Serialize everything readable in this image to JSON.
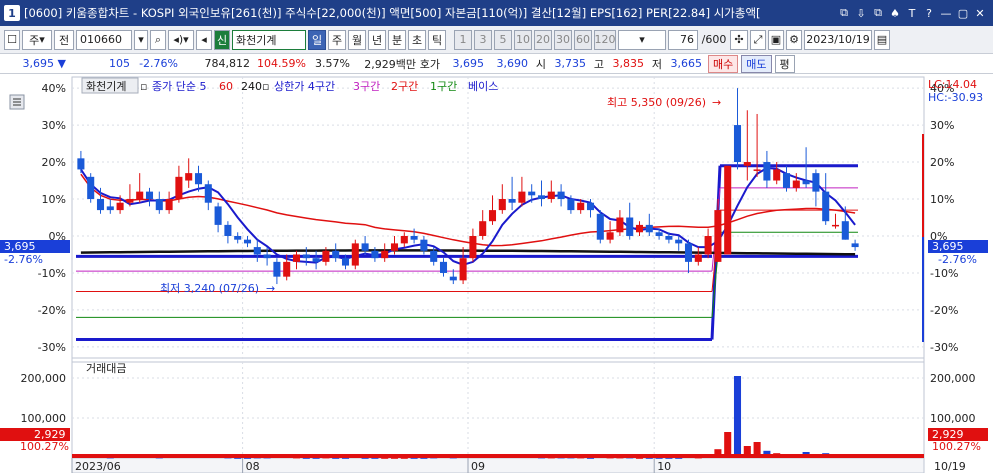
{
  "window": {
    "number": "1",
    "title": "[0600] 키움종합차트 - KOSPI 외국인보유[261(천)] 주식수[22,000(천)] 액면[500] 자본금[110(억)] 결산[12월] EPS[162] PER[22.84] 시가총액[",
    "buttons": [
      "⧉",
      "⇩",
      "⧉",
      "♠",
      "T",
      "?",
      "—",
      "▢",
      "✕"
    ]
  },
  "toolbar": {
    "mode1": "주",
    "mode2": "전",
    "code": "010660",
    "signal_label": "신",
    "stock_name": "화천기계",
    "periods": [
      "일",
      "주",
      "월",
      "년",
      "분",
      "초",
      "틱"
    ],
    "selected_period": "일",
    "intervals": [
      "1",
      "3",
      "5",
      "10",
      "20",
      "30",
      "60",
      "120"
    ],
    "count_value": "76",
    "count_total": "/600",
    "date": "2023/10/19"
  },
  "pricebar": {
    "price": "3,695",
    "change": "105",
    "change_pct": "-2.76%",
    "volume": "784,812",
    "volume_ratio": "104.59%",
    "turnover": "3.57%",
    "amount": "2,929백만",
    "quote_label": "호가",
    "ask": "3,695",
    "bid": "3,690",
    "open_label": "시",
    "open": "3,735",
    "high_label": "고",
    "high": "3,835",
    "low_label": "저",
    "low": "3,665",
    "buy_label": "매수",
    "sell_label": "매도",
    "eval_label": "평"
  },
  "legend": {
    "name": "화천기계",
    "items": [
      {
        "text": "종가 단순 5",
        "color": "#1a1acc"
      },
      {
        "text": "60",
        "color": "#e01010"
      },
      {
        "text": "240",
        "color": "#111111"
      },
      {
        "text": "상한가 4구간",
        "color": "#1a1acc"
      },
      {
        "text": "3구간",
        "color": "#c020c0"
      },
      {
        "text": "2구간",
        "color": "#e01010"
      },
      {
        "text": "1구간",
        "color": "#118811"
      },
      {
        "text": "베이스",
        "color": "#1a1acc"
      }
    ]
  },
  "annotations": {
    "high": "최고 5,350 (09/26)",
    "low": "최저 3,240 (07/26)",
    "lc": "LC:14.04",
    "hc": "HC:-30.93",
    "cur_price": "3,695",
    "cur_pct": "-2.76%",
    "vol_title": "거래대금",
    "vol_value": "2,929",
    "vol_pct": "100.27%"
  },
  "chart_data": {
    "type": "candlestick",
    "price_axis_ticks": [
      "40%",
      "30%",
      "20%",
      "10%",
      "0%",
      "-10%",
      "-20%",
      "-30%"
    ],
    "volume_axis_ticks": [
      "200,000",
      "100,000"
    ],
    "x_ticks": [
      "2023/06",
      "08",
      "09",
      "10",
      "10/19"
    ],
    "ylim_pct": [
      -33,
      43
    ],
    "vol_ylim": [
      0,
      215000
    ],
    "candles": [
      {
        "o": 21,
        "c": 18,
        "h": 23,
        "l": 17
      },
      {
        "o": 16,
        "c": 10,
        "h": 17,
        "l": 9
      },
      {
        "o": 10,
        "c": 7,
        "h": 13,
        "l": 6
      },
      {
        "o": 8,
        "c": 7,
        "h": 10,
        "l": 6
      },
      {
        "o": 7,
        "c": 9,
        "h": 11,
        "l": 6
      },
      {
        "o": 9,
        "c": 10,
        "h": 14,
        "l": 8
      },
      {
        "o": 10,
        "c": 12,
        "h": 17,
        "l": 9
      },
      {
        "o": 12,
        "c": 10,
        "h": 13,
        "l": 8
      },
      {
        "o": 10,
        "c": 7,
        "h": 12,
        "l": 6
      },
      {
        "o": 7,
        "c": 10,
        "h": 12,
        "l": 6
      },
      {
        "o": 10,
        "c": 16,
        "h": 19,
        "l": 9
      },
      {
        "o": 15,
        "c": 17,
        "h": 21,
        "l": 13
      },
      {
        "o": 17,
        "c": 14,
        "h": 19,
        "l": 12
      },
      {
        "o": 14,
        "c": 9,
        "h": 15,
        "l": 7
      },
      {
        "o": 8,
        "c": 3,
        "h": 9,
        "l": 1
      },
      {
        "o": 3,
        "c": 0,
        "h": 4,
        "l": -2
      },
      {
        "o": 0,
        "c": -1,
        "h": 1,
        "l": -2
      },
      {
        "o": -1,
        "c": -2,
        "h": 0,
        "l": -3
      },
      {
        "o": -3,
        "c": -5,
        "h": -1,
        "l": -7
      },
      {
        "o": -5,
        "c": -6,
        "h": -3,
        "l": -8
      },
      {
        "o": -7,
        "c": -11,
        "h": -6,
        "l": -13
      },
      {
        "o": -11,
        "c": -7,
        "h": -5,
        "l": -12
      },
      {
        "o": -7,
        "c": -5,
        "h": -4,
        "l": -9
      },
      {
        "o": -5,
        "c": -6,
        "h": -3,
        "l": -8
      },
      {
        "o": -6,
        "c": -7,
        "h": -4,
        "l": -9
      },
      {
        "o": -7,
        "c": -4,
        "h": -3,
        "l": -8
      },
      {
        "o": -4,
        "c": -6,
        "h": -2,
        "l": -7
      },
      {
        "o": -6,
        "c": -8,
        "h": -5,
        "l": -9
      },
      {
        "o": -8,
        "c": -2,
        "h": -1,
        "l": -9
      },
      {
        "o": -2,
        "c": -4,
        "h": 0,
        "l": -5
      },
      {
        "o": -4,
        "c": -6,
        "h": -3,
        "l": -7
      },
      {
        "o": -6,
        "c": -4,
        "h": -2,
        "l": -7
      },
      {
        "o": -4,
        "c": -2,
        "h": 0,
        "l": -5
      },
      {
        "o": -2,
        "c": 0,
        "h": 1,
        "l": -3
      },
      {
        "o": 0,
        "c": -1,
        "h": 2,
        "l": -2
      },
      {
        "o": -1,
        "c": -4,
        "h": 0,
        "l": -5
      },
      {
        "o": -4,
        "c": -7,
        "h": -3,
        "l": -8
      },
      {
        "o": -7,
        "c": -10,
        "h": -6,
        "l": -11
      },
      {
        "o": -11,
        "c": -12,
        "h": -9,
        "l": -13
      },
      {
        "o": -12,
        "c": -6,
        "h": -3,
        "l": -13
      },
      {
        "o": -6,
        "c": 0,
        "h": 2,
        "l": -7
      },
      {
        "o": 0,
        "c": 4,
        "h": 7,
        "l": -1
      },
      {
        "o": 4,
        "c": 7,
        "h": 11,
        "l": 3
      },
      {
        "o": 7,
        "c": 10,
        "h": 14,
        "l": 6
      },
      {
        "o": 10,
        "c": 9,
        "h": 16,
        "l": 7
      },
      {
        "o": 9,
        "c": 12,
        "h": 16,
        "l": 8
      },
      {
        "o": 12,
        "c": 11,
        "h": 14,
        "l": 9
      },
      {
        "o": 11,
        "c": 10,
        "h": 15,
        "l": 8
      },
      {
        "o": 10,
        "c": 12,
        "h": 15,
        "l": 9
      },
      {
        "o": 12,
        "c": 10,
        "h": 14,
        "l": 8
      },
      {
        "o": 10,
        "c": 7,
        "h": 11,
        "l": 6
      },
      {
        "o": 7,
        "c": 9,
        "h": 10,
        "l": 6
      },
      {
        "o": 9,
        "c": 7,
        "h": 10,
        "l": 5
      },
      {
        "o": 6,
        "c": -1,
        "h": 7,
        "l": -2
      },
      {
        "o": -1,
        "c": 1,
        "h": 4,
        "l": -2
      },
      {
        "o": 1,
        "c": 5,
        "h": 7,
        "l": 0
      },
      {
        "o": 5,
        "c": 0,
        "h": 9,
        "l": -1
      },
      {
        "o": 1,
        "c": 3,
        "h": 4,
        "l": 0
      },
      {
        "o": 3,
        "c": 1,
        "h": 6,
        "l": 0
      },
      {
        "o": 1,
        "c": 0,
        "h": 2,
        "l": -1
      },
      {
        "o": 0,
        "c": -1,
        "h": 1,
        "l": -2
      },
      {
        "o": -1,
        "c": -2,
        "h": 0,
        "l": -4
      },
      {
        "o": -2,
        "c": -7,
        "h": -1,
        "l": -10
      },
      {
        "o": -7,
        "c": -5,
        "h": -3,
        "l": -8
      },
      {
        "o": -5,
        "c": 0,
        "h": 2,
        "l": -6
      },
      {
        "o": -7,
        "c": 7,
        "h": 10,
        "l": -7
      },
      {
        "o": -5,
        "c": 19,
        "h": 19,
        "l": -5
      },
      {
        "o": 30,
        "c": 20,
        "h": 40,
        "l": 18
      },
      {
        "o": 19,
        "c": 20,
        "h": 34,
        "l": 15
      },
      {
        "o": 18,
        "c": 18,
        "h": 33,
        "l": 16
      },
      {
        "o": 20,
        "c": 15,
        "h": 23,
        "l": 13
      },
      {
        "o": 15,
        "c": 18,
        "h": 20,
        "l": 14
      },
      {
        "o": 17,
        "c": 13,
        "h": 19,
        "l": 12
      },
      {
        "o": 13,
        "c": 15,
        "h": 17,
        "l": 12
      },
      {
        "o": 15,
        "c": 14,
        "h": 24,
        "l": 13
      },
      {
        "o": 17,
        "c": 12,
        "h": 18,
        "l": 8
      },
      {
        "o": 12,
        "c": 4,
        "h": 17,
        "l": 3
      },
      {
        "o": 3,
        "c": 3,
        "h": 6,
        "l": 2
      },
      {
        "o": 4,
        "c": -1,
        "h": 8,
        "l": -1
      },
      {
        "o": -2,
        "c": -3,
        "h": -1,
        "l": -4
      }
    ],
    "volumes": [
      8000,
      6000,
      5000,
      4000,
      5000,
      6000,
      7000,
      5000,
      4000,
      5000,
      8000,
      6000,
      5000,
      5000,
      5000,
      4000,
      3000,
      3000,
      4000,
      4000,
      6000,
      5000,
      4000,
      3000,
      3000,
      4000,
      3000,
      3000,
      5000,
      3000,
      3000,
      3000,
      3000,
      3000,
      3000,
      3000,
      4000,
      5000,
      4000,
      6000,
      8000,
      9000,
      8000,
      7000,
      6000,
      6000,
      5000,
      4000,
      4000,
      4000,
      4000,
      4000,
      3000,
      5000,
      4000,
      4000,
      4000,
      3000,
      3000,
      3000,
      3000,
      3000,
      5000,
      4000,
      6000,
      22000,
      65000,
      205000,
      30000,
      40000,
      18000,
      12000,
      8000,
      10000,
      15000,
      8000,
      12000,
      6000,
      7000,
      8000
    ]
  }
}
